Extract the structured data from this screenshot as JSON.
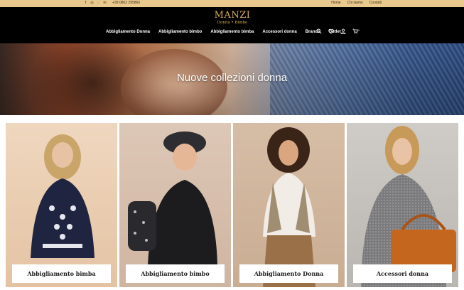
{
  "topbar": {
    "social_icons": [
      "facebook-icon",
      "instagram-icon",
      "whatsapp-icon",
      "email-icon"
    ],
    "phone": "+39 0862 295860",
    "links": [
      "Home",
      "Chi siamo",
      "Contatti"
    ]
  },
  "header": {
    "logo_name": "MANZI",
    "logo_sub": "Donna • Bimbo",
    "nav": [
      "Abbigliamento Donna",
      "Abbigliamento bimbo",
      "Abbigliamento bimba",
      "Accessori donna",
      "Brands",
      "Outlet"
    ],
    "icons": [
      "search-icon",
      "heart-icon",
      "user-icon",
      "cart-icon"
    ],
    "cart_count": "0"
  },
  "hero": {
    "title": "Nuove collezioni donna"
  },
  "cards": [
    {
      "label": "Abbigliamento bimba"
    },
    {
      "label": "Abbigliamento bimbo"
    },
    {
      "label": "Abbigliamento Donna"
    },
    {
      "label": "Accessori donna"
    }
  ],
  "colors": {
    "topbar": "#e9c98e",
    "header": "#000000",
    "logo_gold": "#d8ad5a"
  }
}
